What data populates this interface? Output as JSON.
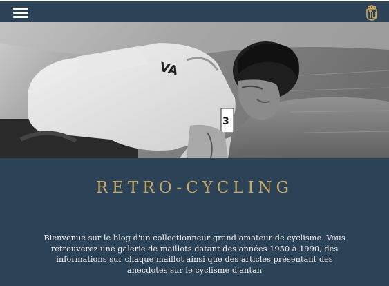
{
  "navbar": {
    "menu_icon": "hamburger-menu-icon",
    "logo_icon": "retro-cycling-monogram-logo"
  },
  "hero": {
    "image": "black-and-white photo of a cyclist in a numbered racing jersey riding bent over the handlebars"
  },
  "main": {
    "title": "RETRO-CYCLING",
    "intro": "Bienvenue sur le blog d'un collectionneur grand amateur de cyclisme. Vous retrouverez une galerie de maillots datant des années 1950 à 1990, des informations sur chaque maillot ainsi que des articles présentant des anecdotes sur le cyclisme d'antan"
  },
  "colors": {
    "navbar_bg": "#2b4257",
    "title_gold": "#c8a765",
    "text_light": "#f2f2f2"
  }
}
